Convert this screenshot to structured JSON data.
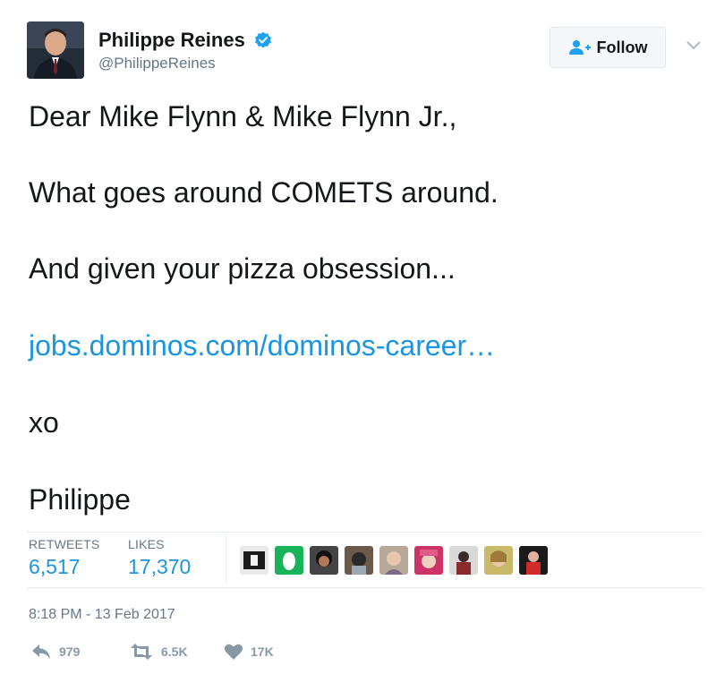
{
  "author": {
    "display_name": "Philippe Reines",
    "handle": "@PhilippeReines",
    "verified_icon": "verified-badge-icon"
  },
  "follow_button": {
    "label": "Follow",
    "icon": "follow-person-plus-icon"
  },
  "tweet": {
    "lines": [
      "Dear Mike Flynn & Mike Flynn Jr.,",
      "What goes around COMETS around.",
      "And given your pizza obsession...",
      "xo",
      "Philippe"
    ],
    "link": "jobs.dominos.com/dominos-career…"
  },
  "stats": {
    "retweets_label": "RETWEETS",
    "retweets_value": "6,517",
    "likes_label": "LIKES",
    "likes_value": "17,370"
  },
  "liker_avatars_count": 9,
  "timestamp": "8:18 PM - 13 Feb 2017",
  "actions": {
    "reply_count": "979",
    "retweet_count": "6.5K",
    "like_count": "17K"
  },
  "colors": {
    "link_blue": "#1b95e0",
    "verified_blue": "#1da1f2",
    "muted_gray": "#657786",
    "action_gray": "#8899a6"
  }
}
